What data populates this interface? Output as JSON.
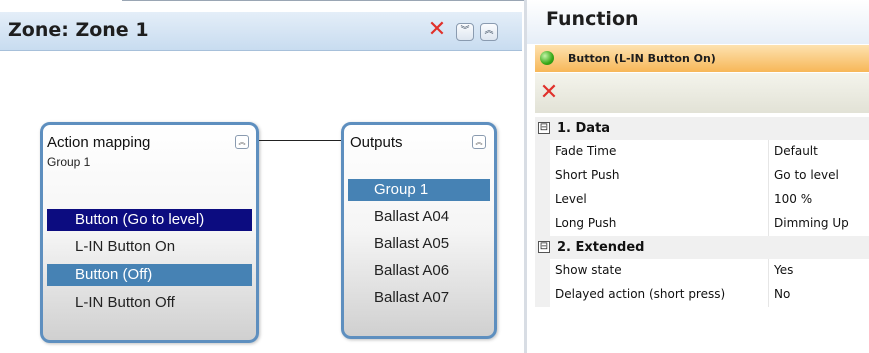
{
  "zone": {
    "title": "Zone: Zone 1"
  },
  "action_mapping": {
    "title": "Action mapping",
    "subtitle": "Group 1",
    "items": [
      "Button (Go to level)",
      "L-IN Button On",
      "Button (Off)",
      "L-IN Button Off"
    ]
  },
  "outputs": {
    "title": "Outputs",
    "items": [
      "Group 1",
      "Ballast A04",
      "Ballast A05",
      "Ballast A06",
      "Ballast A07"
    ]
  },
  "function": {
    "title": "Function",
    "selected_button": "Button (L-IN Button On)",
    "categories": [
      {
        "label": "1. Data",
        "toggle": "⊟",
        "rows": [
          {
            "name": "Fade Time",
            "value": "Default"
          },
          {
            "name": "Short Push",
            "value": "Go to level"
          },
          {
            "name": "Level",
            "value": "100 %"
          },
          {
            "name": "Long Push",
            "value": "Dimming Up"
          }
        ]
      },
      {
        "label": "2. Extended",
        "toggle": "⊟",
        "rows": [
          {
            "name": "Show state",
            "value": "Yes"
          },
          {
            "name": "Delayed action (short press)",
            "value": "No"
          }
        ]
      }
    ]
  },
  "icons": {
    "close": "close-icon",
    "collapse": "chevron-double-down-icon",
    "expand": "chevron-double-up-icon",
    "status": "green-status-icon",
    "delete": "delete-icon"
  },
  "colors": {
    "selected_dark": "#0c0c80",
    "selected_blue": "#4682b4",
    "node_border": "#5e8fbf",
    "accent_orange": "#f7b758",
    "delete_red": "#e0302a"
  }
}
